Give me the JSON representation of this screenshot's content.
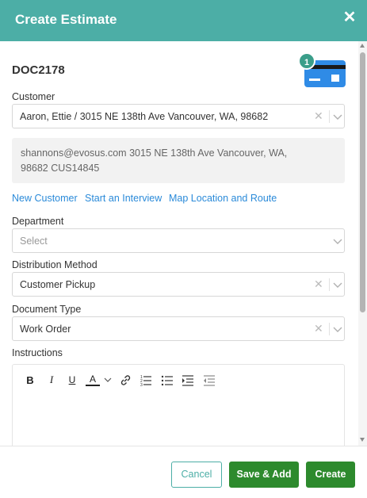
{
  "header": {
    "title": "Create Estimate",
    "close_glyph": "✕"
  },
  "document": {
    "id": "DOC2178",
    "badge_count": "1",
    "icon": "credit-card-icon"
  },
  "customer": {
    "label": "Customer",
    "value": "Aaron, Ettie / 3015 NE 138th Ave Vancouver, WA, 98682",
    "info_line1": "shannons@evosus.com     3015 NE 138th Ave Vancouver, WA,",
    "info_line2": "98682    CUS14845"
  },
  "links": {
    "new_customer": "New Customer",
    "start_interview": "Start an Interview",
    "map_location": "Map Location and Route"
  },
  "department": {
    "label": "Department",
    "placeholder": "Select"
  },
  "distribution": {
    "label": "Distribution Method",
    "value": "Customer Pickup"
  },
  "doc_type": {
    "label": "Document Type",
    "value": "Work Order"
  },
  "instructions": {
    "label": "Instructions",
    "toolbar": {
      "bold": "B",
      "italic": "I",
      "underline": "U",
      "font_color": "A"
    }
  },
  "footer": {
    "cancel": "Cancel",
    "save_add": "Save & Add",
    "create": "Create"
  },
  "colors": {
    "header": "#4caea6",
    "primary_button": "#2d8a2d",
    "link": "#2a8ad9",
    "badge": "#3b9e8a",
    "card": "#2f8be6"
  },
  "icons": {
    "clear": "clear-x-icon",
    "caret": "chevron-down-icon"
  }
}
